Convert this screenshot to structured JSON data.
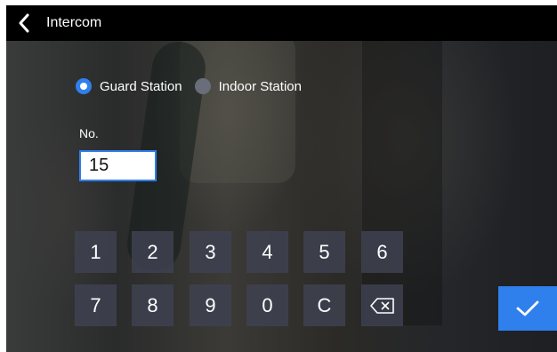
{
  "header": {
    "title": "Intercom",
    "back_icon": "chevron-left-icon"
  },
  "station_type": {
    "options": [
      {
        "label": "Guard Station",
        "selected": true
      },
      {
        "label": "Indoor Station",
        "selected": false
      }
    ]
  },
  "number_field": {
    "label": "No.",
    "value": "15"
  },
  "keypad": {
    "row1": [
      "1",
      "2",
      "3",
      "4",
      "5",
      "6"
    ],
    "row2": [
      "7",
      "8",
      "9",
      "0",
      "C"
    ],
    "backspace_icon": "backspace-icon"
  },
  "confirm": {
    "icon": "checkmark-icon"
  },
  "colors": {
    "accent": "#2f80ed",
    "titlebar": "#000000",
    "key_bg": "#3e4250"
  }
}
